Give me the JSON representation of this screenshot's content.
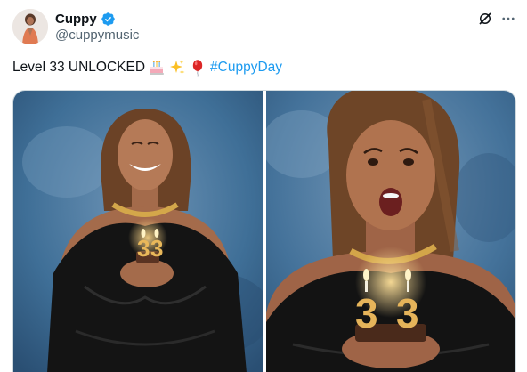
{
  "author": {
    "display_name": "Cuppy",
    "handle": "@cuppymusic",
    "verified": true,
    "avatar_icon": "profile-photo-avatar"
  },
  "actions": {
    "grok_icon": "grok-icon",
    "more_icon": "more-options-icon"
  },
  "tweet": {
    "text": "Level 33 UNLOCKED",
    "emojis": [
      "birthday-cake-emoji",
      "sparkles-emoji",
      "red-balloon-emoji"
    ],
    "hashtag": "#CuppyDay"
  },
  "media": {
    "photos": [
      {
        "name": "photo-smiling-with-candles",
        "candles": "3 3"
      },
      {
        "name": "photo-surprised-with-candles",
        "candles": "3 3"
      }
    ]
  },
  "colors": {
    "link": "#1d9bf0",
    "verified": "#1d9bf0",
    "secondary_text": "#536471",
    "backdrop": "#3f6f97"
  }
}
